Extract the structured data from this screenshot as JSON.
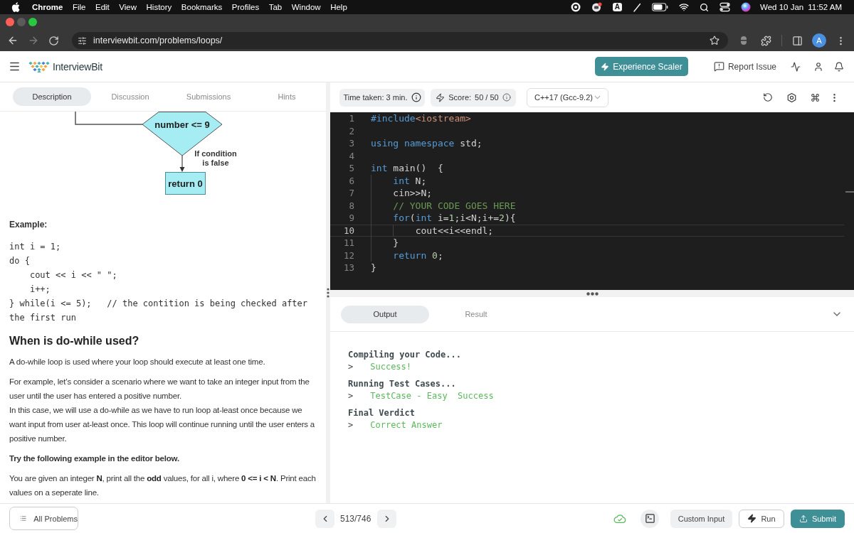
{
  "menu_bar": {
    "app": "Chrome",
    "items": [
      "File",
      "Edit",
      "View",
      "History",
      "Bookmarks",
      "Profiles",
      "Tab",
      "Window",
      "Help"
    ],
    "input_source": "A",
    "date": "Wed 10 Jan",
    "time": "11:52 AM"
  },
  "browser": {
    "url": "interviewbit.com/problems/loops/",
    "profile_initial": "A"
  },
  "header": {
    "logo": "InterviewBit",
    "cta": "Experience Scaler",
    "report": "Report Issue"
  },
  "problem_tabs": [
    {
      "label": "Description",
      "selected": true
    },
    {
      "label": "Discussion",
      "selected": false
    },
    {
      "label": "Submissions",
      "selected": false
    },
    {
      "label": "Hints",
      "selected": false
    }
  ],
  "flowchart": {
    "decision": "number <= 9",
    "false_label": "If condition is false",
    "end": "return 0"
  },
  "article": {
    "example_label": "Example:",
    "example_code": [
      "int i = 1;",
      "do {",
      "    cout << i << \" \";",
      "    i++;",
      "} while(i <= 5);   // the contition is being checked after the first run"
    ],
    "heading": "When is do-while used?",
    "paragraphs": [
      {
        "kind": "text",
        "text": "A do-while loop is used where your loop should execute at least one time."
      },
      {
        "kind": "text",
        "text": "For example, let’s consider a scenario where we want to take an integer input from the user until the user has entered a positive number."
      },
      {
        "kind": "continued",
        "text": "In this case, we will use a do-while as we have to run loop at-least once because we want input from user at-least once. This loop will continue running until the user enters a positive number."
      },
      {
        "kind": "strong",
        "text": "Try the following example in the editor below."
      },
      {
        "kind": "text",
        "text": "You are given an integer **N**, print all the **odd** values, for all i, where **0 <= i < N**. Print each values on a seperate line."
      }
    ]
  },
  "editor": {
    "time_taken": "Time taken: 3 min.",
    "score_label": "Score:",
    "score": "50 / 50",
    "language": "C++17 (Gcc-9.2)",
    "lines": [
      {
        "number": "1",
        "active": false,
        "tokens": [
          {
            "kind": "keyword",
            "text": "#include"
          },
          {
            "kind": "string",
            "text": "<iostream>"
          }
        ]
      },
      {
        "number": "2",
        "active": false
      },
      {
        "number": "3",
        "active": false,
        "tokens": [
          {
            "kind": "keyword",
            "text": "using namespace"
          },
          {
            "kind": "plain",
            "text": " std;"
          }
        ]
      },
      {
        "number": "4",
        "active": false
      },
      {
        "number": "5",
        "active": false,
        "tokens": [
          {
            "kind": "keyword",
            "text": "int"
          },
          {
            "kind": "plain",
            "text": " main()  {"
          }
        ]
      },
      {
        "number": "6",
        "active": false,
        "tokens": [
          {
            "kind": "keyword",
            "text": "    int"
          },
          {
            "kind": "plain",
            "text": " N;"
          }
        ]
      },
      {
        "number": "7",
        "active": false,
        "tokens": [
          {
            "kind": "plain",
            "text": "    cin>>N;"
          }
        ]
      },
      {
        "number": "8",
        "active": false,
        "tokens": [
          {
            "kind": "comment",
            "text": "    // YOUR CODE GOES HERE"
          }
        ]
      },
      {
        "number": "9",
        "active": false,
        "tokens": [
          {
            "kind": "keyword",
            "text": "    for"
          },
          {
            "kind": "plain",
            "text": "("
          },
          {
            "kind": "keyword",
            "text": "int"
          },
          {
            "kind": "plain",
            "text": " i="
          },
          {
            "kind": "number",
            "text": "1"
          },
          {
            "kind": "plain",
            "text": ";i<N;i+="
          },
          {
            "kind": "number",
            "text": "2"
          },
          {
            "kind": "plain",
            "text": "){"
          }
        ]
      },
      {
        "number": "10",
        "active": true,
        "tokens": [
          {
            "kind": "plain",
            "text": "        cout<<i<<endl;"
          }
        ]
      },
      {
        "number": "11",
        "active": false,
        "tokens": [
          {
            "kind": "plain",
            "text": "    }"
          }
        ]
      },
      {
        "number": "12",
        "active": false,
        "tokens": [
          {
            "kind": "keyword",
            "text": "    return"
          },
          {
            "kind": "number",
            "text": " 0"
          },
          {
            "kind": "plain",
            "text": ";"
          }
        ]
      },
      {
        "number": "13",
        "active": false,
        "tokens": [
          {
            "kind": "plain",
            "text": "}"
          }
        ]
      }
    ]
  },
  "output": {
    "tabs": [
      {
        "label": "Output",
        "selected": true
      },
      {
        "label": "Result",
        "selected": false
      }
    ],
    "log": [
      {
        "kind": "heading",
        "text": "Compiling your Code..."
      },
      {
        "kind": "result",
        "prompt": ">",
        "text": "Success!"
      },
      {
        "kind": "heading",
        "text": "Running Test Cases..."
      },
      {
        "kind": "result",
        "prompt": ">",
        "text": "TestCase - Easy  Success"
      },
      {
        "kind": "heading",
        "text": "Final Verdict"
      },
      {
        "kind": "result",
        "prompt": ">",
        "text": "Correct Answer"
      }
    ]
  },
  "footer": {
    "all_problems": "All Problems",
    "counter": "513/746",
    "custom_input": "Custom Input",
    "run": "Run",
    "submit": "Submit"
  }
}
